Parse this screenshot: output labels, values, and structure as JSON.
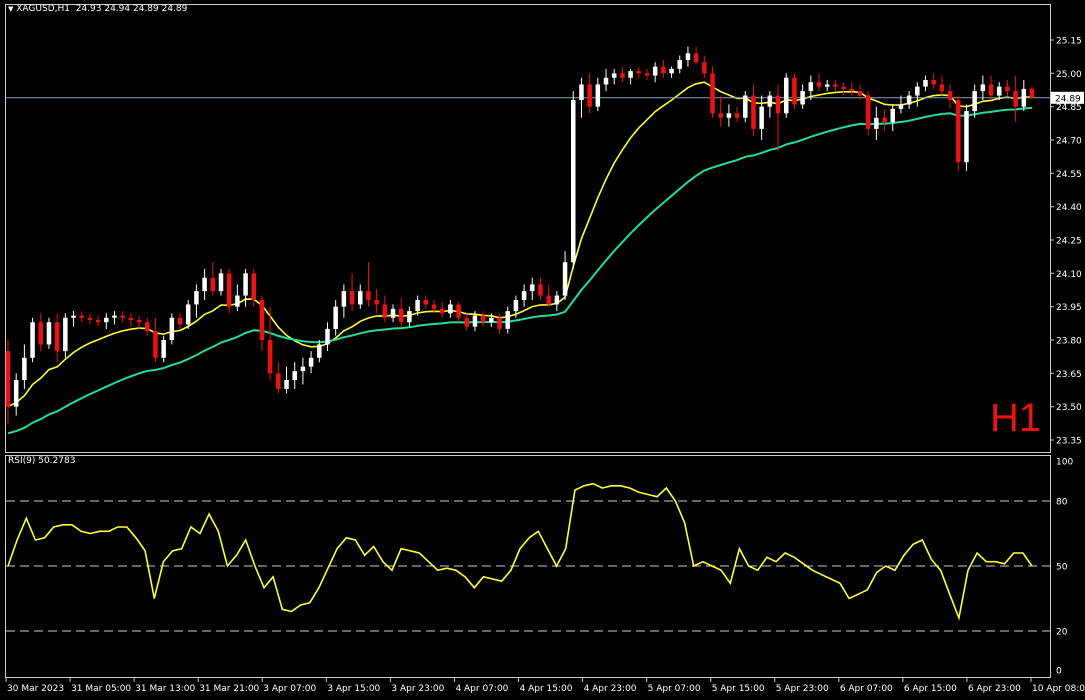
{
  "header": {
    "symbol_timeframe": "XAGUSD,H1",
    "ohlc_text": "24.93 24.94 24.89 24.89"
  },
  "timeframe_watermark": "H1",
  "rsi_panel": {
    "title": "RSI(9) 50.2783"
  },
  "colors": {
    "background": "#000000",
    "bull_candle": "#ffffff",
    "bear_candle": "#ee1111",
    "ma_fast": "#ffff33",
    "ma_slow": "#22dd99",
    "rsi_line": "#ffff33",
    "axis_text": "#ffffff",
    "price_line": "#7fa3b8"
  },
  "icons": {
    "header_menu": "triangle-down-icon"
  },
  "chart_data": [
    {
      "type": "candlestick",
      "title": "XAGUSD,H1",
      "ylim": [
        23.28,
        25.23
      ],
      "y_ticks": [
        "25.15",
        "25.00",
        "24.85",
        "24.70",
        "24.55",
        "24.40",
        "24.25",
        "24.10",
        "23.95",
        "23.80",
        "23.65",
        "23.50",
        "23.35"
      ],
      "x_ticks": [
        "30 Mar 2023",
        "31 Mar 05:00",
        "31 Mar 13:00",
        "31 Mar 21:00",
        "3 Apr 07:00",
        "3 Apr 15:00",
        "3 Apr 23:00",
        "4 Apr 07:00",
        "4 Apr 15:00",
        "4 Apr 23:00",
        "5 Apr 07:00",
        "5 Apr 15:00",
        "5 Apr 23:00",
        "6 Apr 07:00",
        "6 Apr 15:00",
        "6 Apr 23:00",
        "10 Apr 08:00"
      ],
      "current_price": "24.89",
      "bars_approx": [
        [
          23.75,
          23.8,
          23.42,
          23.5
        ],
        [
          23.5,
          23.65,
          23.46,
          23.62
        ],
        [
          23.62,
          23.78,
          23.58,
          23.72
        ],
        [
          23.72,
          23.9,
          23.7,
          23.88
        ],
        [
          23.88,
          23.92,
          23.75,
          23.78
        ],
        [
          23.78,
          23.9,
          23.76,
          23.88
        ],
        [
          23.88,
          23.92,
          23.7,
          23.75
        ],
        [
          23.75,
          23.92,
          23.72,
          23.9
        ],
        [
          23.9,
          23.93,
          23.86,
          23.91
        ],
        [
          23.91,
          23.93,
          23.88,
          23.9
        ],
        [
          23.9,
          23.92,
          23.87,
          23.89
        ],
        [
          23.89,
          23.91,
          23.86,
          23.88
        ],
        [
          23.88,
          23.92,
          23.85,
          23.9
        ],
        [
          23.9,
          23.93,
          23.87,
          23.91
        ],
        [
          23.91,
          23.93,
          23.88,
          23.9
        ],
        [
          23.9,
          23.92,
          23.86,
          23.89
        ],
        [
          23.89,
          23.91,
          23.85,
          23.88
        ],
        [
          23.88,
          23.9,
          23.82,
          23.84
        ],
        [
          23.84,
          23.9,
          23.7,
          23.72
        ],
        [
          23.72,
          23.82,
          23.7,
          23.8
        ],
        [
          23.8,
          23.92,
          23.78,
          23.9
        ],
        [
          23.9,
          23.92,
          23.85,
          23.87
        ],
        [
          23.87,
          23.98,
          23.85,
          23.96
        ],
        [
          23.96,
          24.05,
          23.9,
          24.02
        ],
        [
          24.02,
          24.12,
          23.98,
          24.08
        ],
        [
          24.08,
          24.15,
          24.0,
          24.02
        ],
        [
          24.02,
          24.12,
          24.0,
          24.1
        ],
        [
          24.1,
          24.12,
          23.92,
          23.95
        ],
        [
          23.95,
          24.05,
          23.93,
          24.0
        ],
        [
          24.0,
          24.12,
          23.95,
          24.1
        ],
        [
          24.1,
          24.12,
          23.95,
          23.98
        ],
        [
          23.98,
          24.0,
          23.75,
          23.8
        ],
        [
          23.8,
          23.95,
          23.62,
          23.65
        ],
        [
          23.65,
          23.7,
          23.56,
          23.58
        ],
        [
          23.58,
          23.68,
          23.56,
          23.62
        ],
        [
          23.62,
          23.7,
          23.58,
          23.66
        ],
        [
          23.66,
          23.72,
          23.6,
          23.68
        ],
        [
          23.68,
          23.75,
          23.65,
          23.72
        ],
        [
          23.72,
          23.8,
          23.7,
          23.78
        ],
        [
          23.78,
          23.88,
          23.75,
          23.85
        ],
        [
          23.85,
          23.98,
          23.82,
          23.95
        ],
        [
          23.95,
          24.05,
          23.9,
          24.02
        ],
        [
          24.02,
          24.1,
          23.93,
          23.96
        ],
        [
          23.96,
          24.05,
          23.94,
          24.02
        ],
        [
          24.02,
          24.15,
          23.95,
          23.98
        ],
        [
          23.98,
          24.03,
          23.92,
          23.96
        ],
        [
          23.96,
          24.0,
          23.88,
          23.9
        ],
        [
          23.9,
          23.96,
          23.88,
          23.94
        ],
        [
          23.94,
          23.99,
          23.86,
          23.88
        ],
        [
          23.88,
          23.95,
          23.86,
          23.93
        ],
        [
          23.93,
          24.0,
          23.91,
          23.98
        ],
        [
          23.98,
          24.0,
          23.94,
          23.96
        ],
        [
          23.96,
          23.98,
          23.92,
          23.94
        ],
        [
          23.94,
          23.97,
          23.9,
          23.92
        ],
        [
          23.92,
          23.98,
          23.9,
          23.96
        ],
        [
          23.96,
          23.97,
          23.88,
          23.9
        ],
        [
          23.9,
          23.92,
          23.84,
          23.86
        ],
        [
          23.86,
          23.93,
          23.84,
          23.91
        ],
        [
          23.91,
          23.93,
          23.86,
          23.88
        ],
        [
          23.88,
          23.92,
          23.86,
          23.9
        ],
        [
          23.9,
          23.92,
          23.83,
          23.85
        ],
        [
          23.85,
          23.95,
          23.83,
          23.93
        ],
        [
          23.93,
          24.0,
          23.9,
          23.98
        ],
        [
          23.98,
          24.05,
          23.95,
          24.02
        ],
        [
          24.02,
          24.08,
          23.98,
          24.05
        ],
        [
          24.05,
          24.08,
          23.98,
          24.0
        ],
        [
          24.0,
          24.05,
          23.95,
          23.96
        ],
        [
          23.96,
          24.02,
          23.93,
          24.0
        ],
        [
          24.0,
          24.2,
          23.98,
          24.15
        ],
        [
          24.15,
          24.92,
          24.12,
          24.88
        ],
        [
          24.88,
          24.98,
          24.8,
          24.95
        ],
        [
          24.95,
          25.0,
          24.82,
          24.85
        ],
        [
          24.85,
          24.98,
          24.83,
          24.95
        ],
        [
          24.95,
          25.02,
          24.92,
          24.98
        ],
        [
          24.98,
          25.02,
          24.95,
          25.0
        ],
        [
          25.0,
          25.03,
          24.96,
          24.98
        ],
        [
          24.98,
          25.02,
          24.95,
          25.01
        ],
        [
          25.01,
          25.03,
          24.98,
          25.0
        ],
        [
          25.0,
          25.02,
          24.97,
          24.99
        ],
        [
          24.99,
          25.05,
          24.96,
          25.03
        ],
        [
          25.03,
          25.06,
          24.98,
          25.0
        ],
        [
          25.0,
          25.03,
          24.98,
          25.02
        ],
        [
          25.02,
          25.08,
          25.0,
          25.06
        ],
        [
          25.06,
          25.12,
          25.03,
          25.09
        ],
        [
          25.09,
          25.12,
          25.04,
          25.05
        ],
        [
          25.05,
          25.08,
          24.98,
          25.0
        ],
        [
          25.0,
          25.03,
          24.8,
          24.82
        ],
        [
          24.82,
          24.9,
          24.76,
          24.8
        ],
        [
          24.8,
          24.86,
          24.76,
          24.82
        ],
        [
          24.82,
          24.85,
          24.78,
          24.8
        ],
        [
          24.8,
          24.92,
          24.78,
          24.9
        ],
        [
          24.9,
          24.95,
          24.72,
          24.75
        ],
        [
          24.75,
          24.9,
          24.7,
          24.85
        ],
        [
          24.85,
          24.92,
          24.8,
          24.9
        ],
        [
          24.9,
          24.95,
          24.65,
          24.82
        ],
        [
          24.82,
          25.0,
          24.8,
          24.98
        ],
        [
          24.98,
          25.0,
          24.84,
          24.86
        ],
        [
          24.86,
          24.95,
          24.84,
          24.92
        ],
        [
          24.92,
          24.99,
          24.88,
          24.96
        ],
        [
          24.96,
          25.0,
          24.92,
          24.94
        ],
        [
          24.94,
          24.97,
          24.92,
          24.95
        ],
        [
          24.95,
          24.97,
          24.92,
          24.94
        ],
        [
          24.94,
          24.96,
          24.9,
          24.93
        ],
        [
          24.93,
          24.96,
          24.9,
          24.92
        ],
        [
          24.92,
          24.95,
          24.88,
          24.9
        ],
        [
          24.9,
          24.92,
          24.72,
          24.75
        ],
        [
          24.75,
          24.85,
          24.7,
          24.8
        ],
        [
          24.8,
          24.84,
          24.74,
          24.78
        ],
        [
          24.78,
          24.86,
          24.74,
          24.84
        ],
        [
          24.84,
          24.9,
          24.82,
          24.86
        ],
        [
          24.86,
          24.92,
          24.84,
          24.9
        ],
        [
          24.9,
          24.96,
          24.85,
          24.94
        ],
        [
          24.94,
          24.99,
          24.92,
          24.97
        ],
        [
          24.97,
          25.0,
          24.93,
          24.95
        ],
        [
          24.95,
          24.99,
          24.9,
          24.92
        ],
        [
          24.92,
          24.95,
          24.84,
          24.88
        ],
        [
          24.88,
          24.9,
          24.56,
          24.6
        ],
        [
          24.6,
          24.86,
          24.56,
          24.83
        ],
        [
          24.83,
          24.95,
          24.8,
          24.92
        ],
        [
          24.92,
          24.99,
          24.88,
          24.95
        ],
        [
          24.95,
          24.99,
          24.88,
          24.9
        ],
        [
          24.9,
          24.96,
          24.88,
          24.94
        ],
        [
          24.94,
          24.97,
          24.9,
          24.92
        ],
        [
          24.92,
          24.99,
          24.78,
          24.85
        ],
        [
          24.85,
          24.97,
          24.83,
          24.93
        ],
        [
          24.93,
          24.94,
          24.89,
          24.89
        ]
      ]
    },
    {
      "type": "line",
      "title": "RSI(9) 50.2783",
      "ylim": [
        0,
        100
      ],
      "y_ticks": [
        "100",
        "80",
        "50",
        "20",
        "0"
      ],
      "levels": [
        80,
        50,
        20
      ],
      "current_value": 50.2783,
      "values_approx": [
        50,
        62,
        72,
        62,
        63,
        68,
        69,
        69,
        66,
        65,
        66,
        66,
        68,
        68,
        63,
        57,
        35,
        52,
        57,
        58,
        68,
        65,
        74,
        66,
        50,
        55,
        62,
        50,
        40,
        45,
        30,
        29,
        32,
        33,
        40,
        49,
        58,
        63,
        62,
        55,
        59,
        52,
        48,
        58,
        57,
        56,
        52,
        48,
        49,
        48,
        45,
        40,
        45,
        44,
        43,
        48,
        58,
        63,
        66,
        58,
        50,
        58,
        85,
        87,
        88,
        86,
        87,
        87,
        86,
        84,
        83,
        82,
        86,
        80,
        70,
        50,
        52,
        50,
        48,
        42,
        58,
        50,
        48,
        54,
        52,
        56,
        54,
        51,
        48,
        46,
        44,
        42,
        35,
        37,
        39,
        47,
        50,
        48,
        55,
        60,
        62,
        53,
        48,
        37,
        26,
        48,
        56,
        52,
        52,
        51,
        56,
        56,
        50
      ]
    }
  ]
}
